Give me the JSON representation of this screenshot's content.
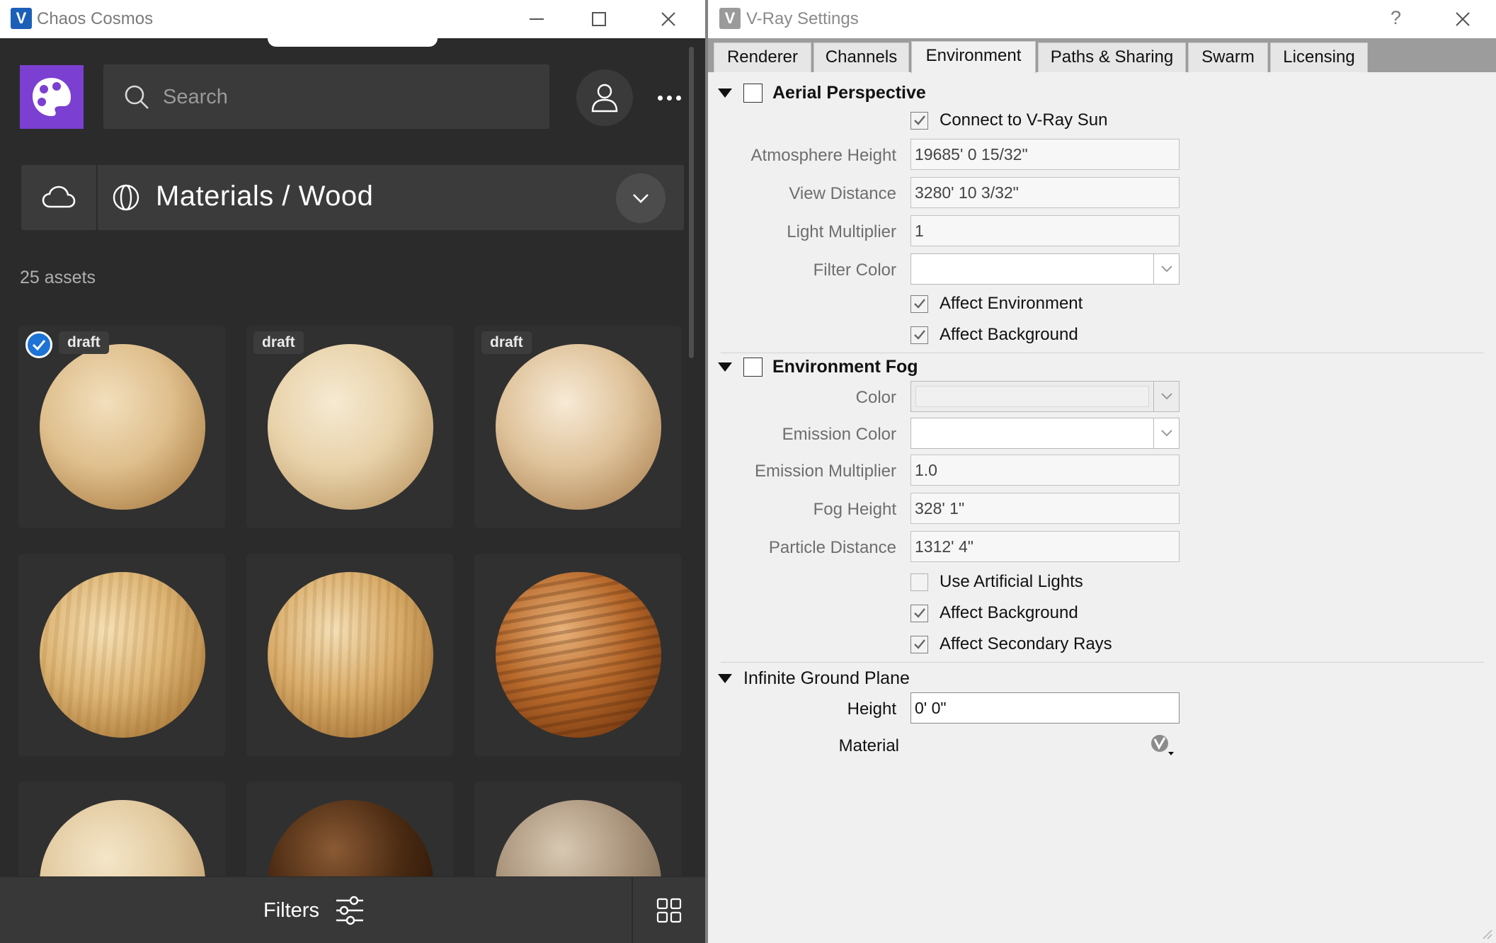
{
  "cosmos": {
    "window_title": "Chaos Cosmos",
    "search_placeholder": "Search",
    "breadcrumb": "Materials / Wood",
    "asset_count": "25 assets",
    "tiles": [
      {
        "badge": "draft",
        "selected": true
      },
      {
        "badge": "draft",
        "selected": false
      },
      {
        "badge": "draft",
        "selected": false
      },
      {
        "badge": "",
        "selected": false
      },
      {
        "badge": "",
        "selected": false
      },
      {
        "badge": "",
        "selected": false
      },
      {
        "badge": "",
        "selected": false
      },
      {
        "badge": "",
        "selected": false
      },
      {
        "badge": "",
        "selected": false
      }
    ],
    "filters_label": "Filters",
    "icons": {
      "logo": "palette-icon",
      "search": "search-icon",
      "user": "user-icon",
      "more": "more-icon",
      "cloud": "cloud-icon",
      "category": "material-icon",
      "dropdown": "chevron-down-icon",
      "filters": "sliders-icon",
      "view": "grid-icon"
    },
    "colors": {
      "accent": "#7b3fd1",
      "selected": "#1d73d6"
    }
  },
  "vray": {
    "window_title": "V-Ray Settings",
    "help": "?",
    "tabs": [
      {
        "label": "Renderer",
        "active": false
      },
      {
        "label": "Channels",
        "active": false
      },
      {
        "label": "Environment",
        "active": true
      },
      {
        "label": "Paths & Sharing",
        "active": false
      },
      {
        "label": "Swarm",
        "active": false
      },
      {
        "label": "Licensing",
        "active": false
      }
    ],
    "aerial": {
      "title": "Aerial Perspective",
      "enabled": false,
      "connect_sun": "Connect to V-Ray Sun",
      "atmosphere_height_label": "Atmosphere Height",
      "atmosphere_height": "19685'  0 15/32\"",
      "view_distance_label": "View Distance",
      "view_distance": "3280'  10 3/32\"",
      "light_multiplier_label": "Light Multiplier",
      "light_multiplier": "1",
      "filter_color_label": "Filter Color",
      "filter_color": "#ffffff",
      "affect_environment": "Affect Environment",
      "affect_background": "Affect Background"
    },
    "fog": {
      "title": "Environment Fog",
      "enabled": false,
      "color_label": "Color",
      "emission_color_label": "Emission Color",
      "emission_color": "#ffffff",
      "emission_multiplier_label": "Emission Multiplier",
      "emission_multiplier": "1.0",
      "fog_height_label": "Fog Height",
      "fog_height": "328'  1\"",
      "particle_distance_label": "Particle Distance",
      "particle_distance": "1312'  4\"",
      "use_artificial_lights": "Use Artificial Lights",
      "affect_background": "Affect Background",
      "affect_secondary_rays": "Affect Secondary Rays"
    },
    "ground": {
      "title": "Infinite Ground Plane",
      "height_label": "Height",
      "height": "0'  0\"",
      "material_label": "Material"
    }
  }
}
